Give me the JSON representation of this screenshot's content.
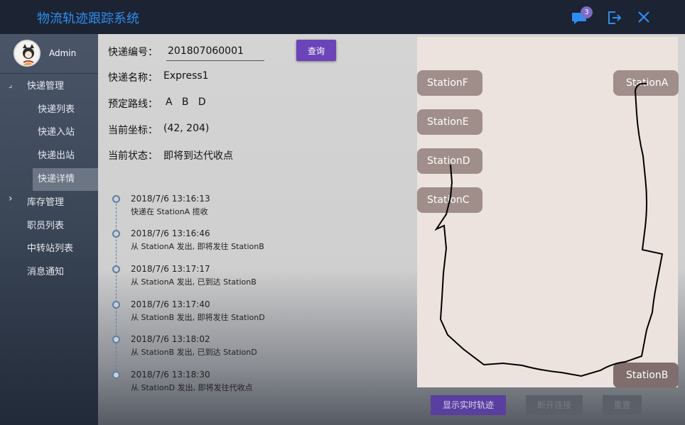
{
  "app": {
    "title": "物流轨迹跟踪系统"
  },
  "header": {
    "notification_count": "3"
  },
  "user": {
    "name": "Admin"
  },
  "sidebar": {
    "items": [
      {
        "label": "快递管理",
        "arrow": "⌟"
      },
      {
        "label": "快递列表"
      },
      {
        "label": "快递入站"
      },
      {
        "label": "快递出站"
      },
      {
        "label": "快递详情"
      },
      {
        "label": "库存管理",
        "arrow": "›"
      },
      {
        "label": "职员列表"
      },
      {
        "label": "中转站列表"
      },
      {
        "label": "消息通知"
      }
    ]
  },
  "form": {
    "number_label": "快递编号：",
    "number_value": "201807060001",
    "query_label": "查询",
    "name_label": "快递名称：",
    "name_value": "Express1",
    "route_label": "预定路线：",
    "route_value": "A   B   D",
    "coord_label": "当前坐标：",
    "coord_value": "(42, 204)",
    "status_label": "当前状态：",
    "status_value": "即将到达代收点"
  },
  "timeline": [
    {
      "time": "2018/7/6 13:16:13",
      "desc": "快递在 StationA 揽收"
    },
    {
      "time": "2018/7/6 13:16:46",
      "desc": "从 StationA 发出, 即将发往 StationB"
    },
    {
      "time": "2018/7/6 13:17:17",
      "desc": "从 StationA 发出, 已到达 StationB"
    },
    {
      "time": "2018/7/6 13:17:40",
      "desc": "从 StationB 发出, 即将发往 StationD"
    },
    {
      "time": "2018/7/6 13:18:02",
      "desc": "从 StationB 发出, 已到达 StationD"
    },
    {
      "time": "2018/7/6 13:18:30",
      "desc": "从 StationD 发出, 即将发往代收点"
    }
  ],
  "map": {
    "stations": {
      "a": "StationA",
      "b": "StationB",
      "c": "StationC",
      "d": "StationD",
      "e": "StationE",
      "f": "StationF"
    }
  },
  "actions": {
    "realtime_label": "显示实时轨迹",
    "disconnect_label": "断开连接",
    "reset_label": "重置"
  },
  "colors": {
    "accent": "#6a44b8",
    "title": "#2e8ef0",
    "station": "#a08e8a",
    "titlebar": "#1c2333"
  }
}
